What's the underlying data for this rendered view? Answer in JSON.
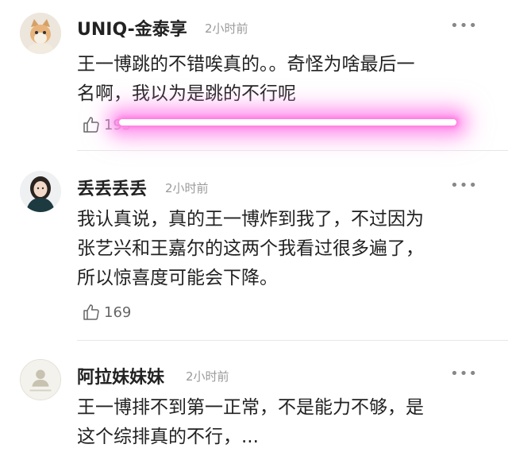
{
  "comments": [
    {
      "username": "UNIQ-金泰享",
      "time": "2小时前",
      "more": "•••",
      "lines": [
        "王一博跳的不错唉真的。。奇怪为啥最后一",
        "名啊，我以为是跳的不行呢"
      ],
      "likes": "195"
    },
    {
      "username": "丢丢丢丢",
      "time": "2小时前",
      "more": "•••",
      "lines": [
        "我认真说，真的王一博炸到我了，不过因为",
        "张艺兴和王嘉尔的这两个我看过很多遍了，",
        "所以惊喜度可能会下降。"
      ],
      "likes": "169"
    },
    {
      "username": "阿拉妹妹妹",
      "time": "2小时前",
      "more": "•••",
      "lines": [
        "王一博排不到第一正常，不是能力不够，是",
        "这个综排真的不行，..."
      ]
    }
  ],
  "icons": {
    "like": "thumbs-up-icon",
    "more": "more-dots-icon"
  },
  "colors": {
    "highlight": "#ff7ae0",
    "timestamp": "#9a9a9a",
    "text": "#222222"
  }
}
